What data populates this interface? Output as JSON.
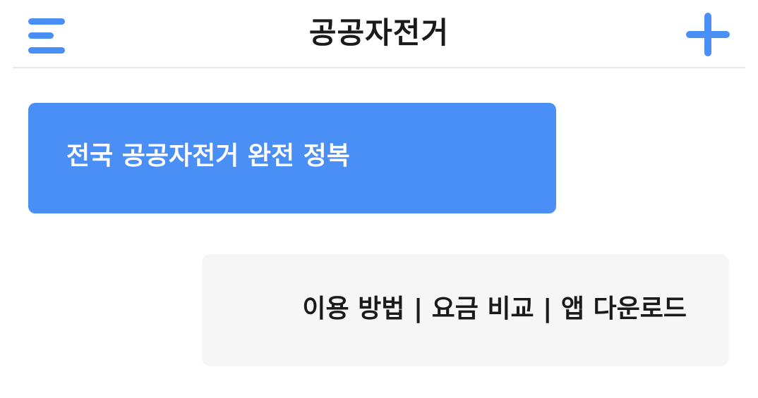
{
  "header": {
    "title": "공공자전거",
    "menu_icon": "hamburger-menu-icon",
    "add_icon": "plus-icon"
  },
  "colors": {
    "accent": "#4a8ff5",
    "title_text": "#1a1a1a",
    "secondary_bubble_bg": "#f6f6f6"
  },
  "messages": [
    {
      "text": "전국 공공자전거 완전 정복"
    },
    {
      "text": "이용 방법 | 요금 비교 | 앱 다운로드"
    }
  ]
}
